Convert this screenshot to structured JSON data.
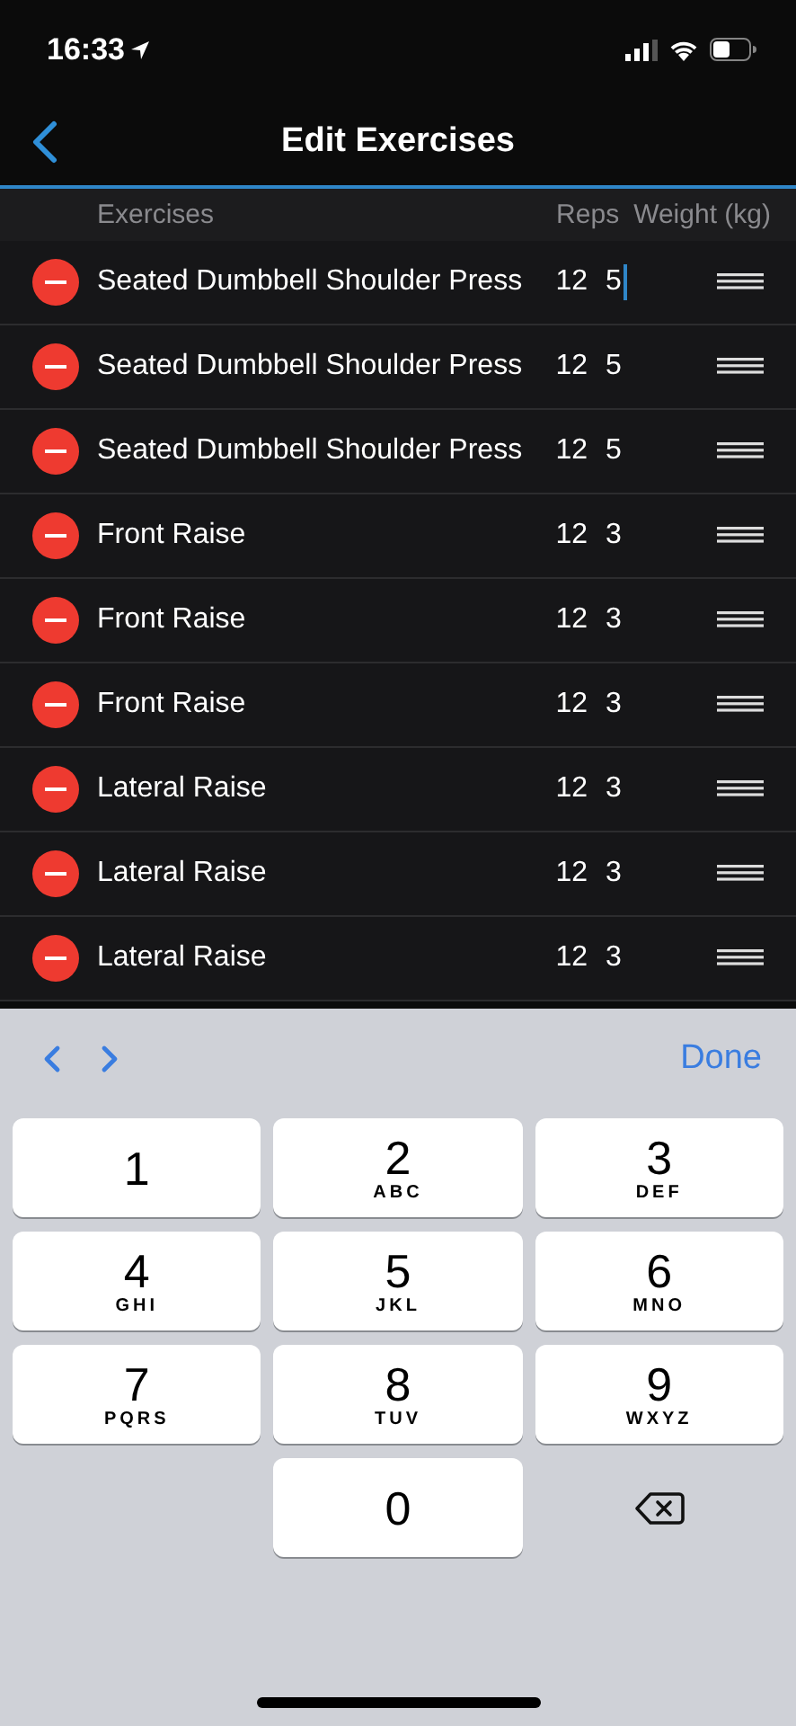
{
  "status_bar": {
    "time": "16:33"
  },
  "nav": {
    "title": "Edit Exercises"
  },
  "table": {
    "columns": [
      "Exercises",
      "Reps",
      "Weight (kg)"
    ],
    "rows": [
      {
        "name": "Seated Dumbbell Shoulder Press",
        "reps": "12",
        "weight": "5",
        "focused": true
      },
      {
        "name": "Seated Dumbbell Shoulder Press",
        "reps": "12",
        "weight": "5",
        "focused": false
      },
      {
        "name": "Seated Dumbbell Shoulder Press",
        "reps": "12",
        "weight": "5",
        "focused": false
      },
      {
        "name": "Front Raise",
        "reps": "12",
        "weight": "3",
        "focused": false
      },
      {
        "name": "Front Raise",
        "reps": "12",
        "weight": "3",
        "focused": false
      },
      {
        "name": "Front Raise",
        "reps": "12",
        "weight": "3",
        "focused": false
      },
      {
        "name": "Lateral Raise",
        "reps": "12",
        "weight": "3",
        "focused": false
      },
      {
        "name": "Lateral Raise",
        "reps": "12",
        "weight": "3",
        "focused": false
      },
      {
        "name": "Lateral Raise",
        "reps": "12",
        "weight": "3",
        "focused": false
      }
    ]
  },
  "keyboard": {
    "done": "Done",
    "keys": [
      {
        "kind": "digit",
        "digit": "1"
      },
      {
        "kind": "digit",
        "digit": "2",
        "letters": "ABC"
      },
      {
        "kind": "digit",
        "digit": "3",
        "letters": "DEF"
      },
      {
        "kind": "digit",
        "digit": "4",
        "letters": "GHI"
      },
      {
        "kind": "digit",
        "digit": "5",
        "letters": "JKL"
      },
      {
        "kind": "digit",
        "digit": "6",
        "letters": "MNO"
      },
      {
        "kind": "digit",
        "digit": "7",
        "letters": "PQRS"
      },
      {
        "kind": "digit",
        "digit": "8",
        "letters": "TUV"
      },
      {
        "kind": "digit",
        "digit": "9",
        "letters": "WXYZ"
      },
      {
        "kind": "blank"
      },
      {
        "kind": "digit",
        "digit": "0"
      },
      {
        "kind": "delete"
      }
    ]
  }
}
